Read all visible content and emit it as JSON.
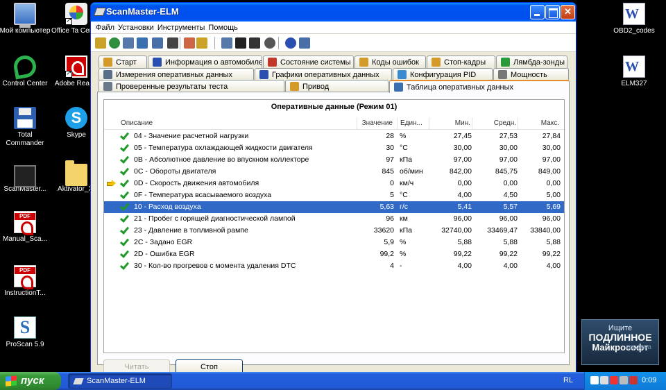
{
  "desktop": {
    "icons_left": [
      {
        "label": "Мой компьютер",
        "icon": "my-computer-icon"
      },
      {
        "label": "Control Center",
        "icon": "control-center-icon"
      },
      {
        "label": "Total Commander",
        "icon": "floppy-icon"
      },
      {
        "label": "ScanMaster...",
        "icon": "chip-icon"
      },
      {
        "label": "Manual_Sca...",
        "icon": "pdf-icon"
      },
      {
        "label": "InstructionT...",
        "icon": "pdf-icon"
      },
      {
        "label": "ProScan 5.9",
        "icon": "proscan-icon"
      }
    ],
    "icons_mid": [
      {
        "label": "Office Ta Center",
        "icon": "office-icon"
      },
      {
        "label": "Adobe Rea XI",
        "icon": "adobe-reader-icon"
      },
      {
        "label": "Skype",
        "icon": "skype-icon"
      },
      {
        "label": "Aktivator_XI",
        "icon": "folder-icon"
      }
    ],
    "icons_right": [
      {
        "label": "OBD2_codes",
        "icon": "word-doc-icon"
      },
      {
        "label": "ELM327",
        "icon": "word-doc-icon"
      }
    ],
    "genuine_banner": {
      "line1": "Ищите",
      "line2": "ПОДЛИННОЕ",
      "line3": "Майкрософт",
      "ghost": "корзина"
    }
  },
  "window": {
    "title": "ScanMaster-ELM",
    "menu": [
      "Файл",
      "Установки",
      "Инструменты",
      "Помощь"
    ],
    "toolbar_icons": [
      "connect-icon",
      "globe-icon",
      "document-icon",
      "table-icon",
      "grid-icon",
      "printer-icon",
      "user-icon",
      "clipboard-icon",
      "chat-icon",
      "terminal-icon",
      "monitor-icon",
      "settings-disc-icon",
      "info-icon",
      "exit-icon"
    ],
    "tabs": {
      "row1": [
        {
          "label": "Старт",
          "icon": "wrench-icon",
          "color": "#d49a2a"
        },
        {
          "label": "Информация о автомобиле",
          "icon": "info-icon",
          "color": "#2a4fb0"
        },
        {
          "label": "Состояние системы",
          "icon": "checklist-icon",
          "color": "#c0392b"
        },
        {
          "label": "Коды ошибок",
          "icon": "engine-icon",
          "color": "#d49a2a"
        },
        {
          "label": "Стоп-кадры",
          "icon": "snapshot-icon",
          "color": "#d49a2a"
        },
        {
          "label": "Лямбда-зонды",
          "icon": "sensor-icon",
          "color": "#2a9b3a"
        }
      ],
      "row2": [
        {
          "label": "Измерения оперативных данных",
          "icon": "gauge-icon",
          "color": "#5a6f8a"
        },
        {
          "label": "Графики оперативных данных",
          "icon": "graph-icon",
          "color": "#2a4fb0"
        },
        {
          "label": "Конфигурация PID",
          "icon": "config-icon",
          "color": "#3a8ad0"
        },
        {
          "label": "Мощность",
          "icon": "power-icon",
          "color": "#777777"
        }
      ],
      "row3": [
        {
          "label": "Проверенные результаты теста",
          "icon": "test-gear-icon",
          "color": "#6a7a8a"
        },
        {
          "label": "Привод",
          "icon": "drive-icon",
          "color": "#d49a2a"
        },
        {
          "label": "Таблица оперативных данных",
          "icon": "table-icon",
          "color": "#3a6fb0",
          "active": true
        }
      ]
    },
    "grid": {
      "title": "Оперативные данные (Режим 01)",
      "columns": {
        "desc": "Описание",
        "value": "Значение",
        "unit": "Един...",
        "min": "Мин.",
        "avg": "Средн.",
        "max": "Макс."
      },
      "rows": [
        {
          "desc": "04 - Значение расчетной нагрузки",
          "value": "28",
          "unit": "%",
          "min": "27,45",
          "avg": "27,53",
          "max": "27,84"
        },
        {
          "desc": "05 - Температура охлаждающей жидкости двигателя",
          "value": "30",
          "unit": "°C",
          "min": "30,00",
          "avg": "30,00",
          "max": "30,00"
        },
        {
          "desc": "0B - Абсолютное давление во впускном коллекторе",
          "value": "97",
          "unit": "кПа",
          "min": "97,00",
          "avg": "97,00",
          "max": "97,00"
        },
        {
          "desc": "0C - Обороты двигателя",
          "value": "845",
          "unit": "об/мин",
          "min": "842,00",
          "avg": "845,75",
          "max": "849,00"
        },
        {
          "desc": "0D - Скорость движения автомобиля",
          "value": "0",
          "unit": "км/ч",
          "min": "0,00",
          "avg": "0,00",
          "max": "0,00",
          "pointer": true
        },
        {
          "desc": "0F - Температура всасываемого воздуха",
          "value": "5",
          "unit": "°C",
          "min": "4,00",
          "avg": "4,50",
          "max": "5,00"
        },
        {
          "desc": "10 - Расход воздуха",
          "value": "5,63",
          "unit": "г/с",
          "min": "5,41",
          "avg": "5,57",
          "max": "5,69",
          "selected": true
        },
        {
          "desc": "21 - Пробег с горящей диагностической лампой",
          "value": "96",
          "unit": "км",
          "min": "96,00",
          "avg": "96,00",
          "max": "96,00"
        },
        {
          "desc": "23 - Давление в топливной рампе",
          "value": "33620",
          "unit": "кПа",
          "min": "32740,00",
          "avg": "33469,47",
          "max": "33840,00"
        },
        {
          "desc": "2C - Задано EGR",
          "value": "5,9",
          "unit": "%",
          "min": "5,88",
          "avg": "5,88",
          "max": "5,88"
        },
        {
          "desc": "2D - Ошибка EGR",
          "value": "99,2",
          "unit": "%",
          "min": "99,22",
          "avg": "99,22",
          "max": "99,22"
        },
        {
          "desc": "30 - Кол-во прогревов с момента удаления DTC",
          "value": "4",
          "unit": "-",
          "min": "4,00",
          "avg": "4,00",
          "max": "4,00"
        }
      ]
    },
    "buttons": {
      "read": "Читать",
      "stop": "Стоп"
    }
  },
  "taskbar": {
    "start_label": "пуск",
    "task_label": "ScanMaster-ELM",
    "lang": "RL",
    "clock": "0:09",
    "tray_icons": [
      "network-icon",
      "speaker-icon",
      "shield-icon",
      "usb-icon",
      "antivirus-icon"
    ]
  }
}
